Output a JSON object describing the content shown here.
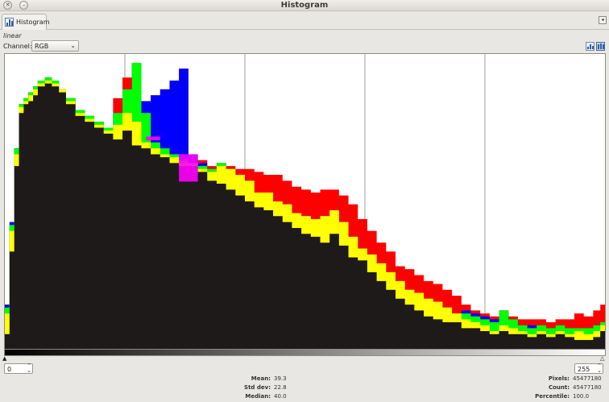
{
  "window": {
    "title": "Histogram"
  },
  "tab": {
    "label": "Histogram"
  },
  "mode": {
    "label": "linear"
  },
  "channel": {
    "label": "Channel:",
    "selected": "RGB"
  },
  "range": {
    "low": "0",
    "high": "255"
  },
  "stats_left": [
    {
      "label": "Mean:",
      "value": "39.3"
    },
    {
      "label": "Std dev:",
      "value": "22.8"
    },
    {
      "label": "Median:",
      "value": "40.0"
    }
  ],
  "stats_right": [
    {
      "label": "Pixels:",
      "value": "45477180"
    },
    {
      "label": "Count:",
      "value": "45477180"
    },
    {
      "label": "Percentile:",
      "value": "100.0"
    }
  ],
  "colors": {
    "red": "#ff0000",
    "yellow": "#ffff00",
    "green": "#00ff00",
    "cyan": "#00ffff",
    "blue": "#0000ff",
    "magenta": "#ff00ff",
    "black": "#1e1a1a"
  },
  "chart_data": {
    "type": "area",
    "x": [
      0,
      2,
      4,
      6,
      8,
      10,
      12,
      14,
      17,
      20,
      23,
      26,
      30,
      34,
      38,
      42,
      46,
      50,
      54,
      58,
      62,
      66,
      70,
      74,
      78,
      82,
      86,
      90,
      94,
      98,
      102,
      106,
      110,
      114,
      118,
      122,
      126,
      130,
      134,
      138,
      142,
      146,
      150,
      154,
      158,
      162,
      166,
      170,
      174,
      178,
      182,
      186,
      190,
      194,
      198,
      202,
      206,
      210,
      214,
      218,
      222,
      226,
      230,
      234,
      238,
      242,
      246,
      250,
      253,
      255
    ],
    "xlim": [
      0,
      255
    ],
    "ylim": [
      0,
      1
    ],
    "grid": "vertical lines at 51, 102, 153, 204",
    "series": [
      {
        "color": "black",
        "values": [
          0.05,
          0.33,
          0.62,
          0.8,
          0.83,
          0.84,
          0.86,
          0.89,
          0.9,
          0.89,
          0.87,
          0.83,
          0.79,
          0.77,
          0.75,
          0.73,
          0.71,
          0.74,
          0.69,
          0.68,
          0.66,
          0.65,
          0.63,
          0.62,
          0.62,
          0.6,
          0.57,
          0.56,
          0.54,
          0.52,
          0.5,
          0.48,
          0.47,
          0.45,
          0.43,
          0.41,
          0.39,
          0.38,
          0.36,
          0.39,
          0.35,
          0.31,
          0.3,
          0.26,
          0.23,
          0.2,
          0.17,
          0.15,
          0.13,
          0.11,
          0.1,
          0.09,
          0.09,
          0.07,
          0.07,
          0.06,
          0.05,
          0.06,
          0.05,
          0.05,
          0.04,
          0.05,
          0.04,
          0.05,
          0.04,
          0.03,
          0.03,
          0.04,
          0.06,
          0.27
        ]
      },
      {
        "color": "yellow",
        "values": [
          0.12,
          0.4,
          0.66,
          0.82,
          0.84,
          0.86,
          0.88,
          0.9,
          0.91,
          0.9,
          0.88,
          0.84,
          0.8,
          0.78,
          0.76,
          0.74,
          0.76,
          0.8,
          0.77,
          0.7,
          0.68,
          0.66,
          0.65,
          0.63,
          0.63,
          0.61,
          0.6,
          0.62,
          0.61,
          0.59,
          0.57,
          0.53,
          0.53,
          0.5,
          0.49,
          0.46,
          0.45,
          0.44,
          0.45,
          0.47,
          0.43,
          0.38,
          0.34,
          0.32,
          0.29,
          0.26,
          0.23,
          0.2,
          0.19,
          0.17,
          0.16,
          0.14,
          0.12,
          0.1,
          0.09,
          0.08,
          0.06,
          0.08,
          0.07,
          0.06,
          0.05,
          0.06,
          0.05,
          0.06,
          0.05,
          0.06,
          0.05,
          0.06,
          0.08,
          0.33
        ]
      },
      {
        "color": "green",
        "values": [
          0.14,
          0.42,
          0.68,
          0.83,
          0.85,
          0.87,
          0.89,
          0.91,
          0.92,
          0.91,
          0.88,
          0.85,
          0.81,
          0.79,
          0.77,
          0.75,
          0.8,
          0.88,
          0.97,
          0.8,
          0.7,
          0.68,
          0.66,
          0.64,
          0.63,
          0.62,
          0.61,
          0.63,
          0.61,
          0.59,
          0.57,
          0.53,
          0.53,
          0.5,
          0.49,
          0.46,
          0.45,
          0.44,
          0.45,
          0.47,
          0.43,
          0.38,
          0.34,
          0.32,
          0.29,
          0.26,
          0.23,
          0.2,
          0.19,
          0.17,
          0.16,
          0.14,
          0.12,
          0.12,
          0.11,
          0.1,
          0.09,
          0.13,
          0.1,
          0.08,
          0.07,
          0.08,
          0.07,
          0.08,
          0.07,
          0.07,
          0.07,
          0.08,
          0.09,
          0.34
        ]
      },
      {
        "color": "blue",
        "values": [
          0.15,
          0.43,
          0.68,
          0.83,
          0.85,
          0.87,
          0.89,
          0.91,
          0.92,
          0.91,
          0.88,
          0.85,
          0.81,
          0.79,
          0.77,
          0.75,
          0.8,
          0.88,
          0.97,
          0.84,
          0.86,
          0.88,
          0.91,
          0.95,
          0.66,
          0.63,
          0.61,
          0.63,
          0.61,
          0.59,
          0.57,
          0.53,
          0.53,
          0.5,
          0.49,
          0.46,
          0.45,
          0.44,
          0.45,
          0.47,
          0.43,
          0.38,
          0.34,
          0.32,
          0.29,
          0.26,
          0.23,
          0.2,
          0.19,
          0.17,
          0.16,
          0.14,
          0.12,
          0.13,
          0.12,
          0.11,
          0.1,
          0.13,
          0.1,
          0.08,
          0.08,
          0.08,
          0.07,
          0.08,
          0.07,
          0.07,
          0.07,
          0.08,
          0.09,
          0.34
        ]
      },
      {
        "color": "red",
        "values": [
          0.15,
          0.43,
          0.68,
          0.83,
          0.85,
          0.87,
          0.89,
          0.91,
          0.92,
          0.91,
          0.88,
          0.85,
          0.81,
          0.79,
          0.77,
          0.75,
          0.85,
          0.92,
          0.97,
          0.84,
          0.86,
          0.88,
          0.91,
          0.95,
          0.66,
          0.64,
          0.62,
          0.63,
          0.62,
          0.61,
          0.61,
          0.6,
          0.59,
          0.59,
          0.57,
          0.55,
          0.54,
          0.53,
          0.54,
          0.54,
          0.52,
          0.49,
          0.44,
          0.4,
          0.36,
          0.33,
          0.28,
          0.27,
          0.25,
          0.23,
          0.22,
          0.2,
          0.18,
          0.15,
          0.13,
          0.12,
          0.11,
          0.13,
          0.11,
          0.1,
          0.1,
          0.1,
          0.09,
          0.1,
          0.1,
          0.12,
          0.11,
          0.13,
          0.15,
          0.34
        ]
      }
    ]
  }
}
